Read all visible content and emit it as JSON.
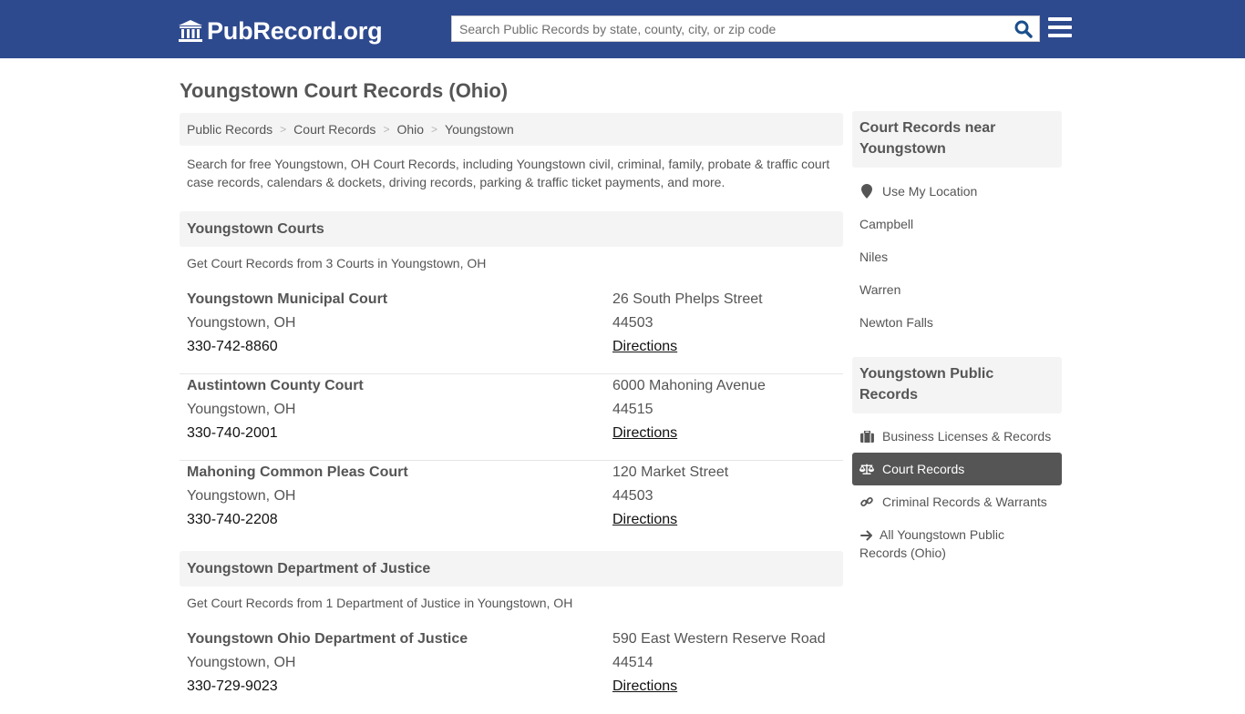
{
  "header": {
    "logo_text": "PubRecord.org",
    "logo_icon": "courthouse-icon",
    "search_placeholder": "Search Public Records by state, county, city, or zip code",
    "search_value": "",
    "search_icon": "search-icon",
    "menu_icon": "hamburger-menu-icon"
  },
  "colors": {
    "header_bg": "#2e4a8f",
    "search_icon": "#1a4f8c",
    "panel_bg": "#f4f4f4",
    "active_item_bg": "#555555",
    "text": "#555555"
  },
  "page": {
    "title": "Youngstown Court Records (Ohio)",
    "breadcrumb": [
      {
        "label": "Public Records"
      },
      {
        "label": "Court Records"
      },
      {
        "label": "Ohio"
      },
      {
        "label": "Youngstown"
      }
    ],
    "breadcrumb_separator": ">",
    "intro": "Search for free Youngstown, OH Court Records, including Youngstown civil, criminal, family, probate & traffic court case records, calendars & dockets, driving records, parking & traffic ticket payments, and more."
  },
  "sections": [
    {
      "title": "Youngstown Courts",
      "subtitle": "Get Court Records from 3 Courts in Youngstown, OH",
      "entries": [
        {
          "name": "Youngstown Municipal Court",
          "city": "Youngstown, OH",
          "phone": "330-742-8860",
          "address": "26 South Phelps Street",
          "zip": "44503",
          "link": "Directions"
        },
        {
          "name": "Austintown County Court",
          "city": "Youngstown, OH",
          "phone": "330-740-2001",
          "address": "6000 Mahoning Avenue",
          "zip": "44515",
          "link": "Directions"
        },
        {
          "name": "Mahoning Common Pleas Court",
          "city": "Youngstown, OH",
          "phone": "330-740-2208",
          "address": "120 Market Street",
          "zip": "44503",
          "link": "Directions"
        }
      ]
    },
    {
      "title": "Youngstown Department of Justice",
      "subtitle": "Get Court Records from 1 Department of Justice in Youngstown, OH",
      "entries": [
        {
          "name": "Youngstown Ohio Department of Justice",
          "city": "Youngstown, OH",
          "phone": "330-729-9023",
          "address": "590 East Western Reserve Road",
          "zip": "44514",
          "link": "Directions"
        }
      ]
    }
  ],
  "sidebar": {
    "nearby": {
      "title": "Court Records near Youngstown",
      "use_location": "Use My Location",
      "use_location_icon": "map-marker-icon",
      "cities": [
        "Campbell",
        "Niles",
        "Warren",
        "Newton Falls"
      ]
    },
    "public_records": {
      "title": "Youngstown Public Records",
      "items": [
        {
          "label": "Business Licenses & Records",
          "icon": "briefcase-icon",
          "active": false
        },
        {
          "label": "Court Records",
          "icon": "balance-scale-icon",
          "active": true
        },
        {
          "label": "Criminal Records & Warrants",
          "icon": "link-icon",
          "active": false
        },
        {
          "label": "All Youngstown Public Records (Ohio)",
          "icon": "arrow-right-icon",
          "active": false
        }
      ]
    }
  }
}
